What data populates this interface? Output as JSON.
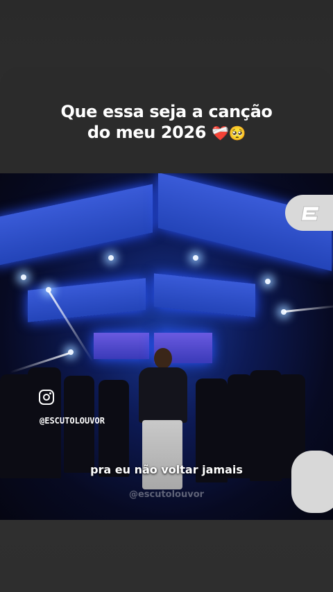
{
  "post": {
    "headline_line1": "Que essa seja a canção",
    "headline_line2": "do meu 2026",
    "headline_emojis": "❤️‍🩹🥺"
  },
  "video": {
    "instagram_handle": "@ESCUTOLOUVOR",
    "lyric": "pra eu não voltar jamais",
    "watermark": "@escutolouvor",
    "logo_icon": "e-logo-icon",
    "social_icon": "instagram-icon"
  },
  "colors": {
    "background": "#2b2b2b",
    "stage_blue": "#2344b8",
    "text": "#ffffff"
  }
}
